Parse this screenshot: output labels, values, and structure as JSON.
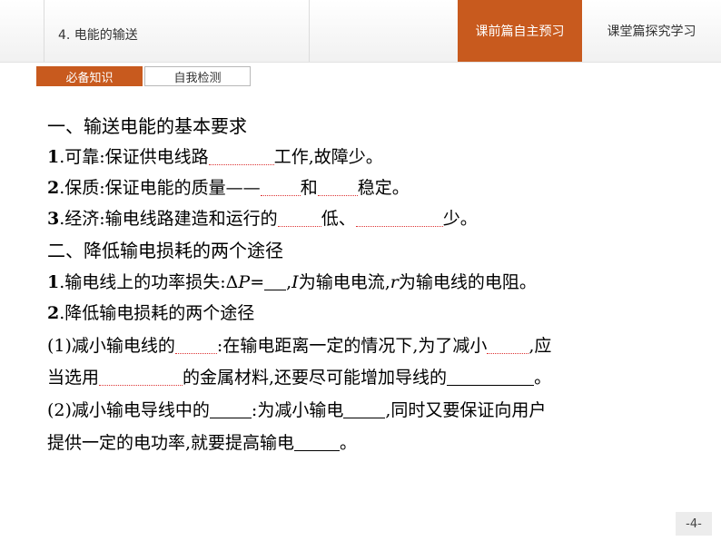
{
  "header": {
    "lesson_title": "4. 电能的输送",
    "tab_preview": "课前篇自主预习",
    "tab_explore": "课堂篇探究学习"
  },
  "subtabs": {
    "knowledge": "必备知识",
    "self_check": "自我检测"
  },
  "content": {
    "h1": "一、输送电能的基本要求",
    "l1_num": "1",
    "l1_a": ".可靠:保证供电线路",
    "l1_b": "工作,故障少。",
    "l2_num": "2",
    "l2_a": ".保质:保证电能的质量——",
    "l2_b": "和",
    "l2_c": "稳定。",
    "l3_num": "3",
    "l3_a": ".经济:输电线路建造和运行的",
    "l3_b": "低、",
    "l3_c": "少。",
    "h2": "二、降低输电损耗的两个途径",
    "l4_num": "1",
    "l4_a": ".输电线上的功率损失:Δ",
    "l4_P": "P",
    "l4_eq": "=",
    "l4_I": "I",
    "l4_b": "为输电电流,",
    "l4_r": "r",
    "l4_c": "为输电线的电阻。",
    "l5_num": "2",
    "l5_a": ".降低输电损耗的两个途径",
    "l6_a": "(1)减小输电线的",
    "l6_b": ":在输电距离一定的情况下,为了减小",
    "l6_c": ",应",
    "l7_a": "当选用",
    "l7_b": "的金属材料,还要尽可能增加导线的",
    "l7_c": "。",
    "l8_a": "(2)减小输电导线中的",
    "l8_b": ":为减小输电",
    "l8_c": ",同时又要保证向用户",
    "l9_a": "提供一定的电功率,就要提高输电",
    "l9_b": "。"
  },
  "footer": {
    "page_number": "-4-"
  }
}
